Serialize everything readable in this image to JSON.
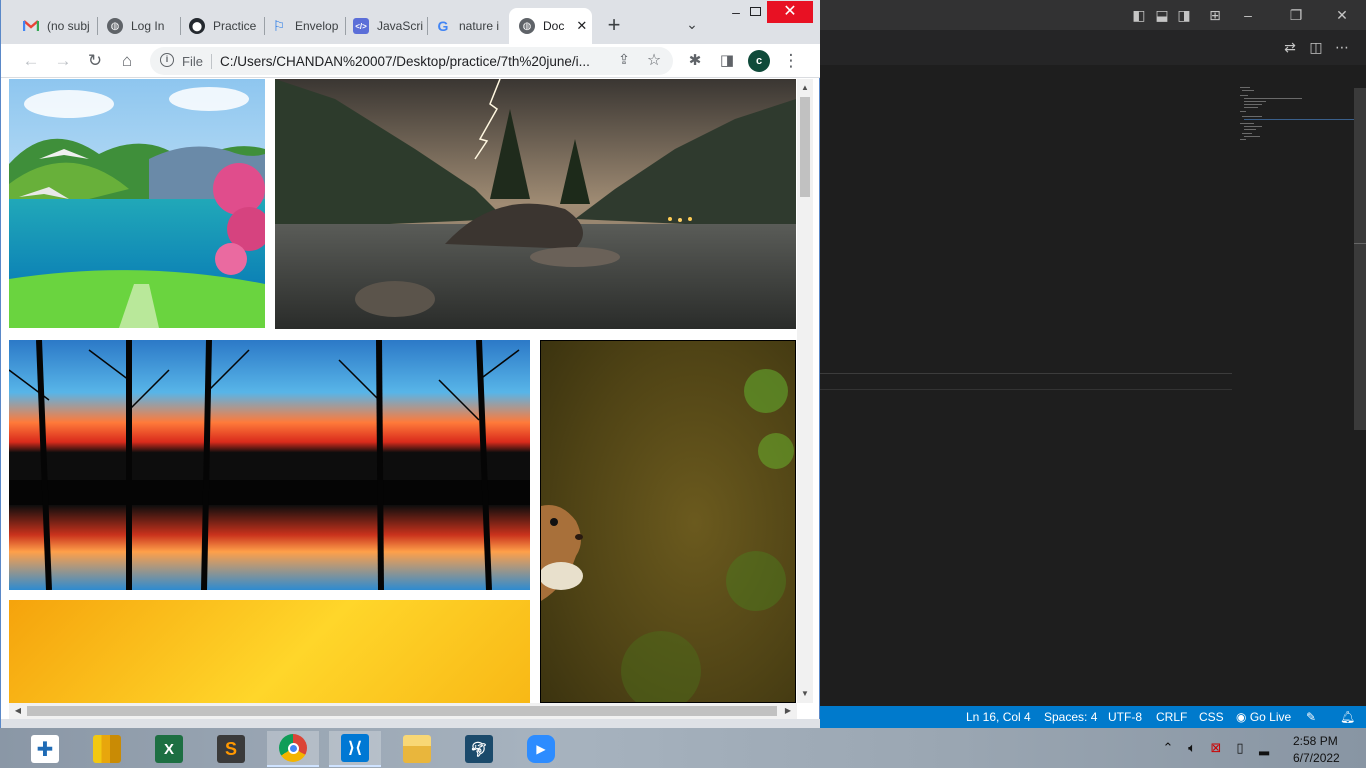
{
  "browser": {
    "tabs": [
      {
        "title": "(no subj",
        "icon": "gmail-icon"
      },
      {
        "title": "Log In",
        "icon": "globe-icon"
      },
      {
        "title": "Practice",
        "icon": "github-icon"
      },
      {
        "title": "Envelop",
        "icon": "flag-icon"
      },
      {
        "title": "JavaScri",
        "icon": "code-icon"
      },
      {
        "title": "nature i",
        "icon": "google-icon"
      },
      {
        "title": "Doc",
        "icon": "globe-icon",
        "active": true
      }
    ],
    "address": {
      "scheme_label": "File",
      "url": "C:/Users/CHANDAN%20007/Desktop/practice/7th%20june/i..."
    },
    "profile_initial": "c",
    "photos": [
      "lake-valley",
      "mountain-lake-lightning",
      "sunset-trees-reflection",
      "squirrel",
      "yellow-gradient"
    ]
  },
  "vscode": {
    "statusbar": {
      "position": "Ln 16, Col 4",
      "spaces": "Spaces: 4",
      "encoding": "UTF-8",
      "eol": "CRLF",
      "language": "CSS",
      "go_live": "Go Live"
    }
  },
  "taskbar": {
    "apps": [
      "tableau",
      "power-bi",
      "excel",
      "sublime-text",
      "chrome",
      "vscode",
      "file-explorer",
      "mysql-workbench",
      "zoom"
    ],
    "active_app": "chrome",
    "time": "2:58 PM",
    "date": "6/7/2022"
  },
  "colors": {
    "vscode_status": "#007acc",
    "close_red": "#e81123",
    "tab_strip": "#dee1e6"
  }
}
